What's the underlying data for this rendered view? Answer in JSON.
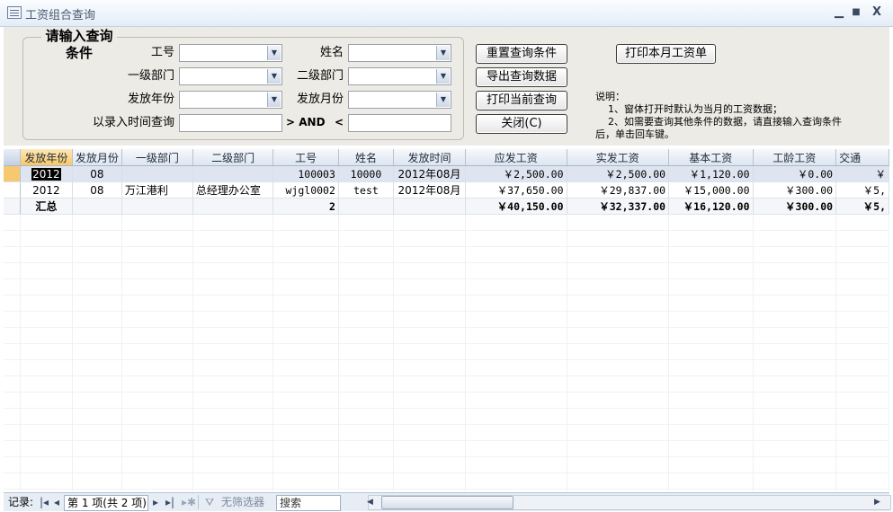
{
  "window": {
    "title": "工资组合查询",
    "minimize": "▁",
    "maximize": "■",
    "close": "X"
  },
  "form": {
    "group_title": "请输入查询条件",
    "labels": {
      "emp_id": "工号",
      "name": "姓名",
      "dept1": "一级部门",
      "dept2": "二级部门",
      "pay_year": "发放年份",
      "pay_month": "发放月份",
      "entry_time": "以录入时间查询"
    },
    "values": {
      "emp_id": "",
      "name": "",
      "dept1": "",
      "dept2": "",
      "pay_year": "",
      "pay_month": "",
      "time_from": "",
      "time_to": ""
    },
    "gt_and": "> AND",
    "lt": "<",
    "buttons": {
      "reset": "重置查询条件",
      "export": "导出查询数据",
      "print_current": "打印当前查询",
      "close": "关闭(C)",
      "print_month": "打印本月工资单"
    },
    "note": [
      "说明：",
      "    1、窗体打开时默认为当月的工资数据；",
      "    2、如需要查询其他条件的数据，请直接输入查询条件",
      "后，单击回车键。"
    ]
  },
  "grid": {
    "columns": [
      "发放年份",
      "发放月份",
      "一级部门",
      "二级部门",
      "工号",
      "姓名",
      "发放时间",
      "应发工资",
      "实发工资",
      "基本工资",
      "工龄工资",
      "交通"
    ],
    "rows": [
      [
        "2012",
        "08",
        "",
        "",
        "100003",
        "10000",
        "2012年08月",
        "￥2,500.00",
        "￥2,500.00",
        "￥1,120.00",
        "￥0.00",
        "￥"
      ],
      [
        "2012",
        "08",
        "万江港利",
        "总经理办公室",
        "wjgl0002",
        "test",
        "2012年08月",
        "￥37,650.00",
        "￥29,837.00",
        "￥15,000.00",
        "￥300.00",
        "￥5,"
      ]
    ],
    "total_row": [
      "汇总",
      "",
      "",
      "",
      "2",
      "",
      "",
      "￥40,150.00",
      "￥32,337.00",
      "￥16,120.00",
      "￥300.00",
      "￥5,"
    ]
  },
  "navbar": {
    "record_label": "记录:",
    "record_text": "第 1 项(共 2 项)",
    "filter_label": "无筛选器",
    "search_label": "搜索"
  }
}
